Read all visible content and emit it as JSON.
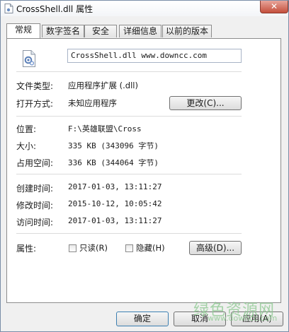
{
  "window": {
    "title": "CrossShell.dll 属性",
    "close_glyph": "✕"
  },
  "tabs": [
    {
      "label": "常规",
      "active": true
    },
    {
      "label": "数字签名",
      "active": false
    },
    {
      "label": "安全",
      "active": false
    },
    {
      "label": "详细信息",
      "active": false
    },
    {
      "label": "以前的版本",
      "active": false
    }
  ],
  "general": {
    "file_name": "CrossShell.dll  www.downcc.com",
    "file_type_label": "文件类型:",
    "file_type_value": "应用程序扩展 (.dll)",
    "open_with_label": "打开方式:",
    "open_with_value": "未知应用程序",
    "change_button": "更改(C)...",
    "location_label": "位置:",
    "location_value": "F:\\英雄联盟\\Cross",
    "size_label": "大小:",
    "size_value": "335 KB (343096 字节)",
    "size_on_disk_label": "占用空间:",
    "size_on_disk_value": "336 KB (344064 字节)",
    "created_label": "创建时间:",
    "created_value": "2017-01-03, 13:11:27",
    "modified_label": "修改时间:",
    "modified_value": "2015-10-12, 10:05:42",
    "accessed_label": "访问时间:",
    "accessed_value": "2017-01-03, 13:11:27",
    "attributes_label": "属性:",
    "readonly_label": "只读(R)",
    "readonly_checked": false,
    "hidden_label": "隐藏(H)",
    "hidden_checked": false,
    "advanced_button": "高级(D)..."
  },
  "footer": {
    "ok_button": "确定",
    "cancel_button": "取消",
    "apply_button": "应用(A)"
  },
  "watermark": {
    "text": "绿色资源网",
    "url": "www.downcc.com"
  },
  "icons": [
    "dll-file-icon",
    "title-file-icon",
    "close-icon"
  ]
}
